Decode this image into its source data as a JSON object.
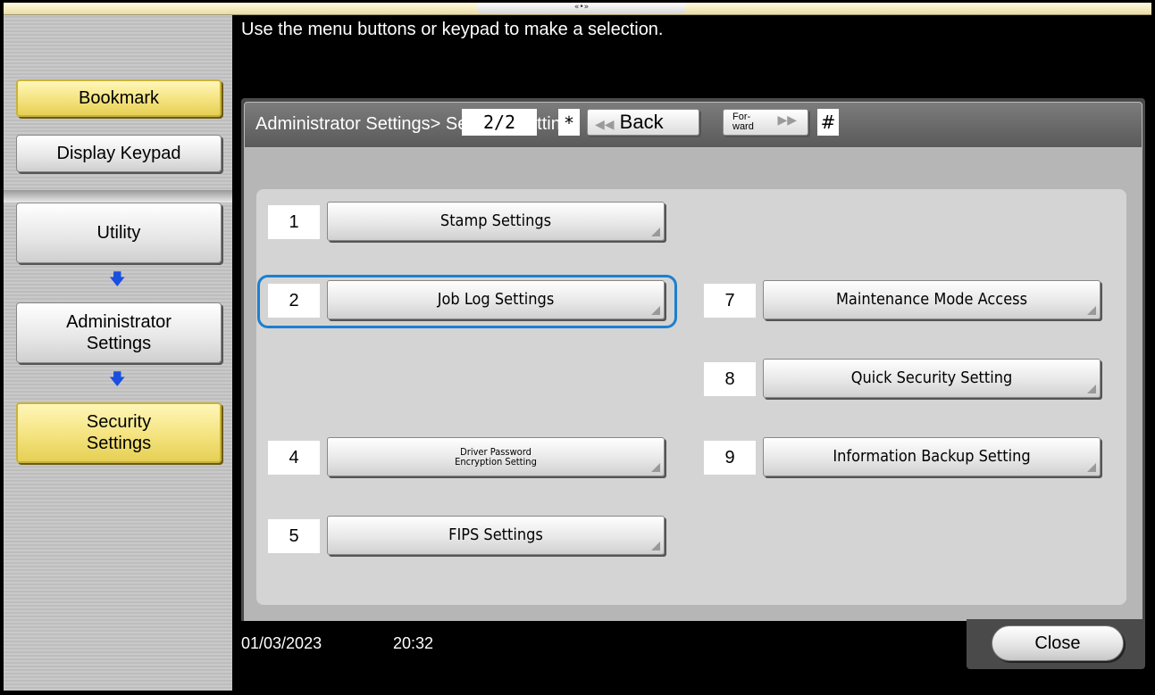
{
  "topbar": {
    "grip_glyph": "«•»"
  },
  "sidebar": {
    "bookmark_label": "Bookmark",
    "display_keypad_label": "Display Keypad",
    "breadcrumb": [
      {
        "label": "Utility"
      },
      {
        "label": "Administrator\nSettings"
      },
      {
        "label": "Security\nSettings"
      }
    ],
    "arrow_icon": "arrow-down-icon"
  },
  "instruction": "Use the menu buttons or keypad to make a selection.",
  "panel": {
    "title": "Administrator Settings> Security Settings"
  },
  "pager": {
    "page_indicator": "2/2",
    "star": "*",
    "back_label": "Back",
    "forward_label_line1": "For-",
    "forward_label_line2": "ward",
    "hash": "#"
  },
  "menu": {
    "items": [
      {
        "number": "1",
        "label": "Stamp Settings"
      },
      {
        "number": "2",
        "label": "Job Log Settings"
      },
      {
        "number": "4",
        "label_line1": "Driver Password",
        "label_line2": "Encryption Setting"
      },
      {
        "number": "5",
        "label": "FIPS Settings"
      },
      {
        "number": "7",
        "label": "Maintenance Mode Access"
      },
      {
        "number": "8",
        "label": "Quick Security Setting"
      },
      {
        "number": "9",
        "label": "Information Backup Setting"
      }
    ],
    "highlight_color": "#1c7fd0"
  },
  "footer": {
    "date": "01/03/2023",
    "time": "20:32",
    "close_label": "Close"
  },
  "colors": {
    "accent_yellow": "#f4e37e",
    "arrow_blue": "#1a4fe0"
  }
}
